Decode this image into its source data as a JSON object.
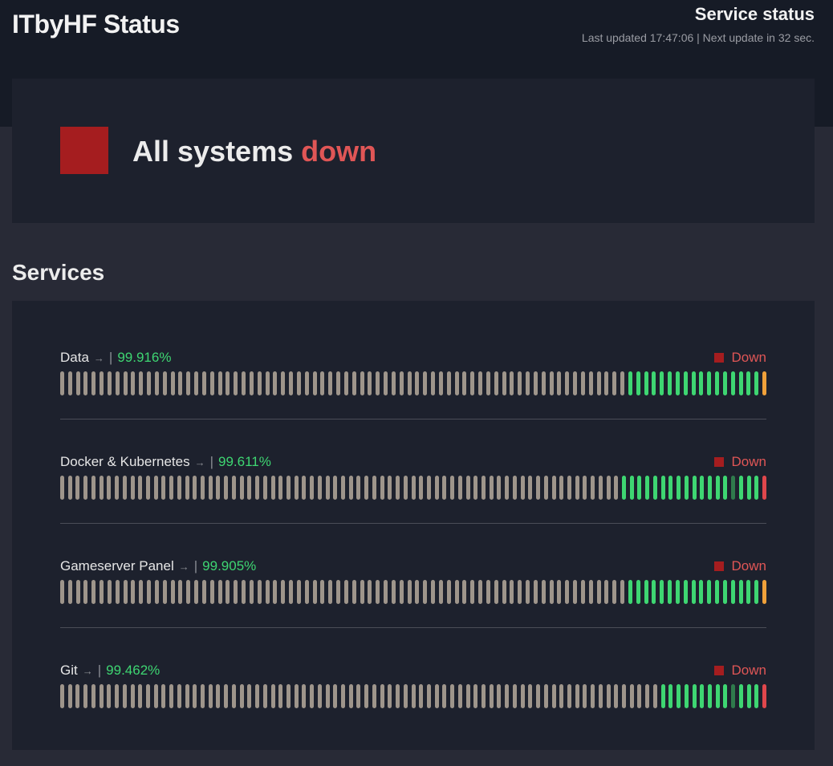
{
  "header": {
    "site_title": "ITbyHF Status",
    "service_status_title": "Service status",
    "last_updated": "Last updated 17:47:06 | Next update in 32 sec."
  },
  "overall": {
    "prefix": "All systems",
    "state_word": "down",
    "color": "#a51d1f"
  },
  "services_heading": "Services",
  "colors": {
    "none": "#9e958b",
    "up": "#3ed672",
    "dim": "#2f7a4c",
    "warn": "#f0a13a",
    "down": "#e0474c",
    "status_down": "#e05656"
  },
  "services": [
    {
      "name": "Data",
      "arrow": "→",
      "separator": "|",
      "uptime": "99.916%",
      "status": "Down",
      "history": "nnnnnnnnnnnnnnnnnnnnnnnnnnnnnnnnnnnnnnnnnnnnnnnnnnnnnnnnnnnnnnnnnnnnnnnnuuuuuuuuuuuuuuuuuw"
    },
    {
      "name": "Docker & Kubernetes",
      "arrow": "→",
      "separator": "|",
      "uptime": "99.611%",
      "status": "Down",
      "history": "nnnnnnnnnnnnnnnnnnnnnnnnnnnnnnnnnnnnnnnnnnnnnnnnnnnnnnnnnnnnnnnnnnnnnnnnuuuuuuuuuuuuuuduuud"
    },
    {
      "name": "Gameserver Panel",
      "arrow": "→",
      "separator": "|",
      "uptime": "99.905%",
      "status": "Down",
      "history": "nnnnnnnnnnnnnnnnnnnnnnnnnnnnnnnnnnnnnnnnnnnnnnnnnnnnnnnnnnnnnnnnnnnnnnnnuuuuuuuuuuuuuuuuuw"
    },
    {
      "name": "Git",
      "arrow": "→",
      "separator": "|",
      "uptime": "99.462%",
      "status": "Down",
      "history": "nnnnnnnnnnnnnnnnnnnnnnnnnnnnnnnnnnnnnnnnnnnnnnnnnnnnnnnnnnnnnnnnnnnnnnnnnnnnnuuuuuuuuuduuud"
    }
  ]
}
